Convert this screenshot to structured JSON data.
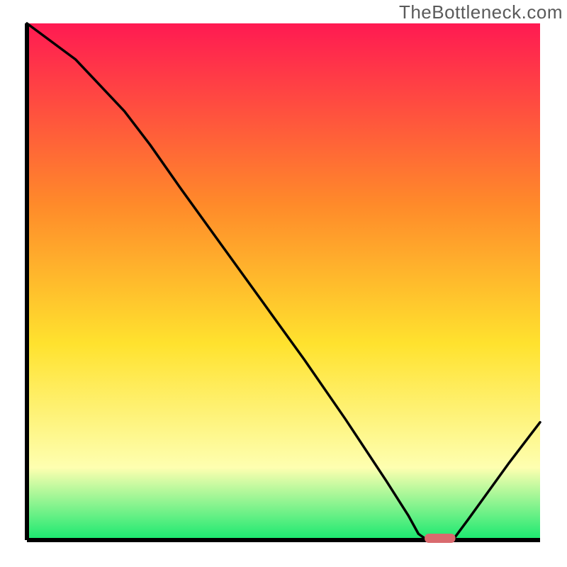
{
  "watermark": "TheBottleneck.com",
  "chart_data": {
    "type": "line",
    "title": "",
    "xlabel": "",
    "ylabel": "",
    "xlim": [
      0,
      100
    ],
    "ylim": [
      0,
      100
    ],
    "gradient_colors": {
      "top": "#ff1a52",
      "mid_upper": "#ff8a2a",
      "mid": "#ffe22e",
      "lower": "#feffb0",
      "bottom": "#17e86f"
    },
    "marker": {
      "color": "#d96a6e",
      "x_start": 77.5,
      "x_end": 83.5,
      "y": 0.0
    },
    "curve": [
      {
        "x": 0.0,
        "y": 100.0
      },
      {
        "x": 9.5,
        "y": 93.0
      },
      {
        "x": 19.0,
        "y": 83.0
      },
      {
        "x": 24.0,
        "y": 76.5
      },
      {
        "x": 30.0,
        "y": 68.0
      },
      {
        "x": 38.0,
        "y": 57.0
      },
      {
        "x": 46.0,
        "y": 46.0
      },
      {
        "x": 54.0,
        "y": 35.0
      },
      {
        "x": 62.0,
        "y": 23.5
      },
      {
        "x": 70.0,
        "y": 11.5
      },
      {
        "x": 74.3,
        "y": 4.8
      },
      {
        "x": 76.3,
        "y": 1.2
      },
      {
        "x": 78.0,
        "y": 0.0
      },
      {
        "x": 83.0,
        "y": 0.0
      },
      {
        "x": 86.0,
        "y": 4.0
      },
      {
        "x": 90.0,
        "y": 9.5
      },
      {
        "x": 94.0,
        "y": 15.0
      },
      {
        "x": 98.0,
        "y": 20.2
      },
      {
        "x": 100.0,
        "y": 22.8
      }
    ]
  }
}
